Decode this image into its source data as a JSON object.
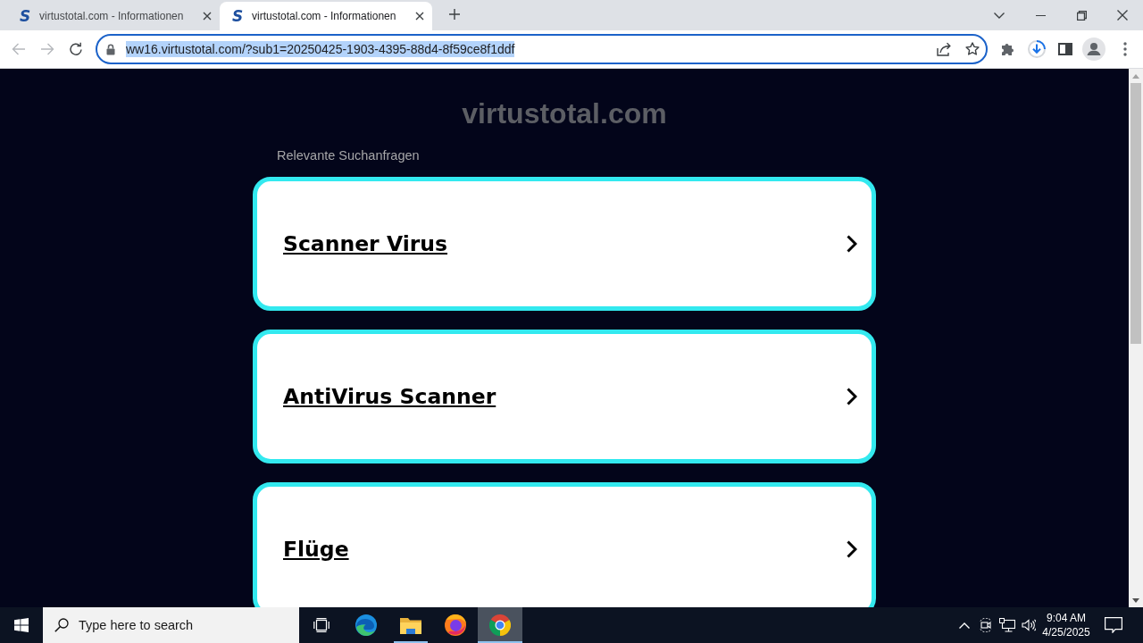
{
  "browser": {
    "tabs": [
      {
        "favicon": "S",
        "title": "virtustotal.com - Informationen",
        "selected": false
      },
      {
        "favicon": "S",
        "title": "virtustotal.com - Informationen",
        "selected": true
      }
    ],
    "navigation": {
      "back": {
        "disabled": true
      },
      "forward": {
        "disabled": true
      }
    },
    "address_bar": {
      "url": "ww16.virtustotal.com/?sub1=20250425-1903-4395-88d4-8f59ce8f1ddf",
      "focused": true,
      "text_selected": true
    }
  },
  "page": {
    "site_title": "virtustotal.com",
    "section_label": "Relevante Suchanfragen",
    "suggestions": [
      {
        "label": "Scanner Virus"
      },
      {
        "label": "AntiVirus Scanner"
      },
      {
        "label": "Flüge"
      }
    ]
  },
  "taskbar": {
    "search": {
      "placeholder": "Type here to search"
    },
    "apps": [
      {
        "kind": "taskview",
        "running": false,
        "selected": false
      },
      {
        "kind": "edge",
        "running": false,
        "selected": false
      },
      {
        "kind": "explorer",
        "running": true,
        "selected": false
      },
      {
        "kind": "firefox",
        "running": false,
        "selected": false
      },
      {
        "kind": "chrome",
        "running": true,
        "selected": true
      }
    ],
    "clock": {
      "time": "9:04 AM",
      "date": "4/25/2025"
    }
  }
}
